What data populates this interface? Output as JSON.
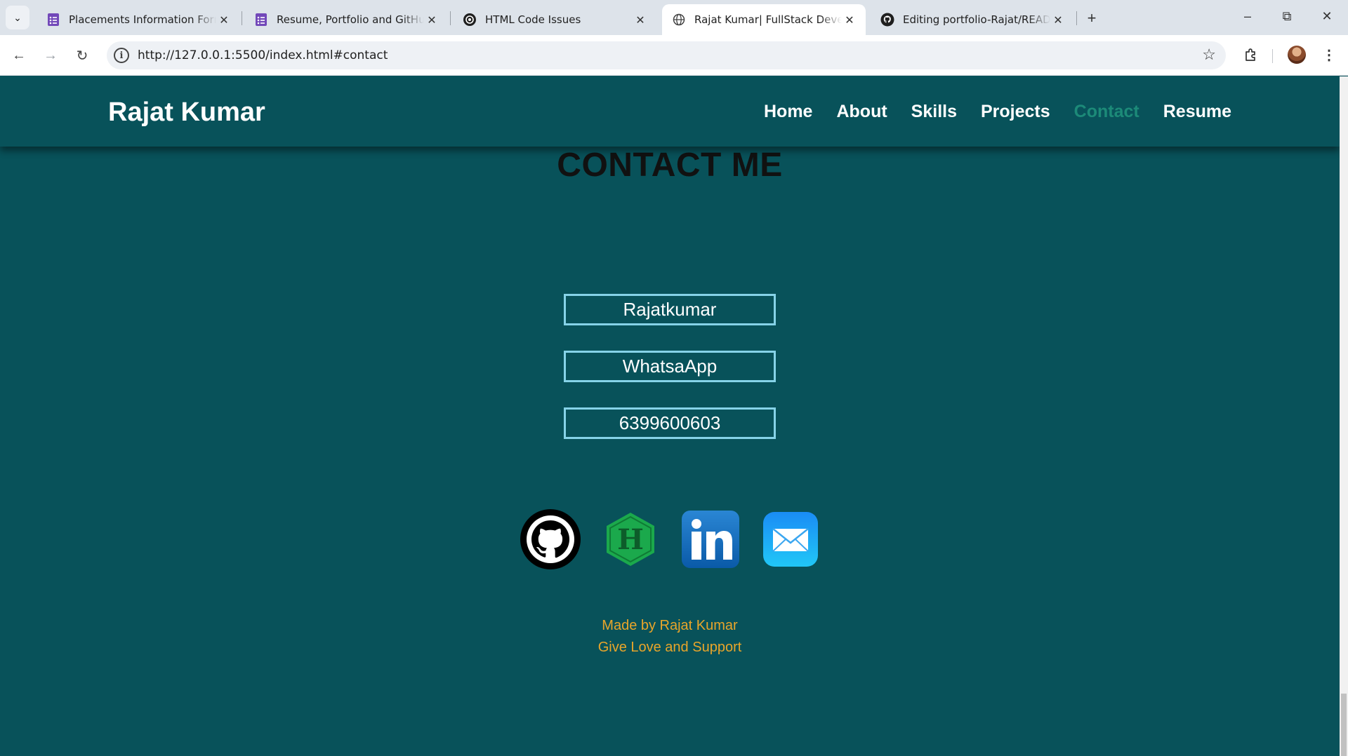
{
  "browser": {
    "tabs": [
      {
        "title": "Placements Information Form -",
        "icon": "google-forms-icon"
      },
      {
        "title": "Resume, Portfolio and GitHub",
        "icon": "google-forms-icon"
      },
      {
        "title": "HTML Code Issues",
        "icon": "chatgpt-icon"
      },
      {
        "title": "Rajat Kumar| FullStack Developer",
        "icon": "globe-icon",
        "active": true
      },
      {
        "title": "Editing portfolio-Rajat/README.md",
        "icon": "github-icon"
      }
    ],
    "url": "http://127.0.0.1:5500/index.html#contact"
  },
  "site": {
    "brand": "Rajat Kumar",
    "nav": [
      {
        "label": "Home"
      },
      {
        "label": "About"
      },
      {
        "label": "Skills"
      },
      {
        "label": "Projects"
      },
      {
        "label": "Contact",
        "current": true
      },
      {
        "label": "Resume"
      }
    ]
  },
  "contact": {
    "title": "CONTACT ME",
    "fields": [
      "Rajatkumar",
      "WhatsaApp",
      "6399600603"
    ],
    "socials": [
      {
        "name": "github-icon"
      },
      {
        "name": "hackerrank-icon"
      },
      {
        "name": "linkedin-icon"
      },
      {
        "name": "mail-icon"
      }
    ]
  },
  "footer": {
    "line1": "Made by Rajat Kumar",
    "line2": "Give Love and Support"
  },
  "colors": {
    "page_bg": "#08525a",
    "nav_active": "#1c8a78",
    "field_border": "#86d3e8",
    "footer_text": "#e8a52a"
  }
}
